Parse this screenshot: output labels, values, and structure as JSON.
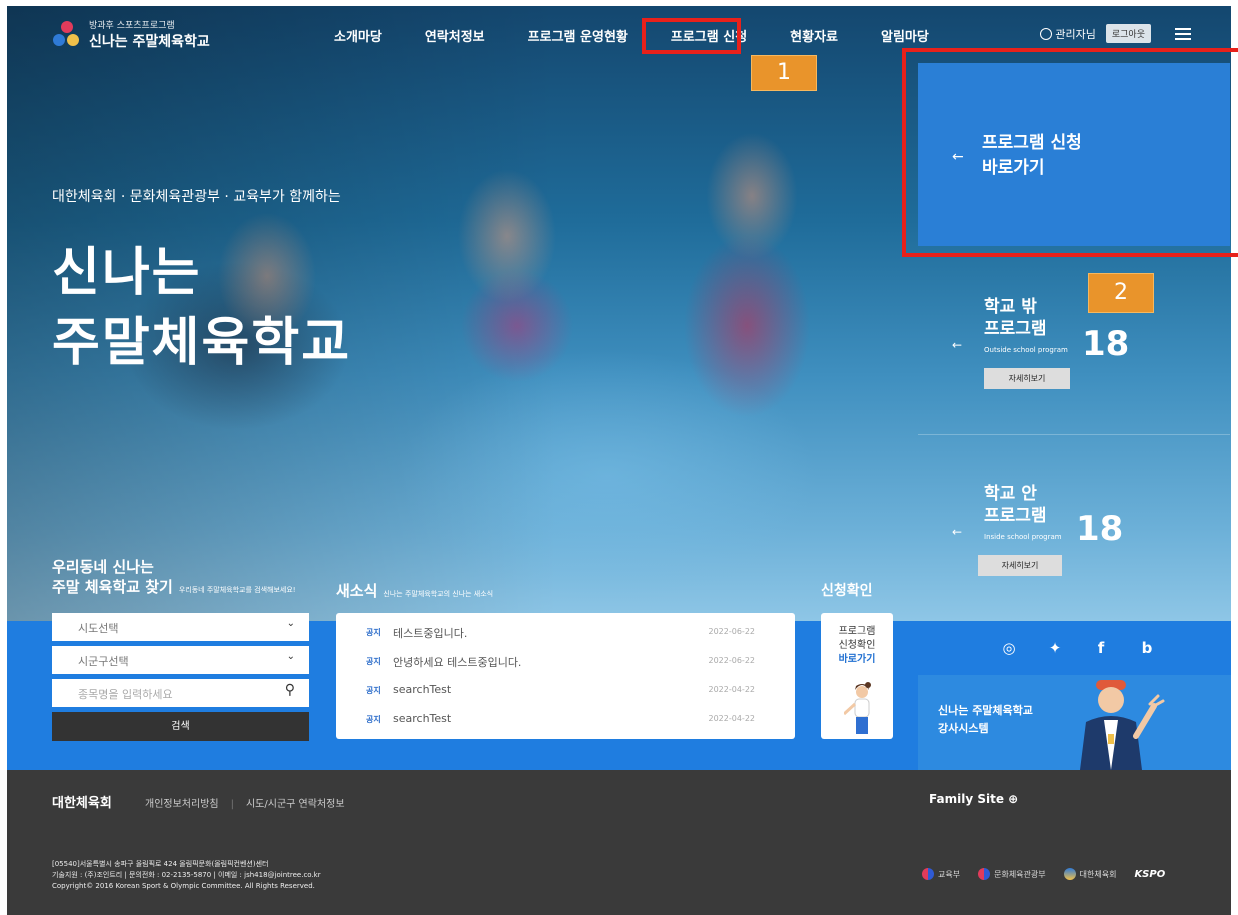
{
  "header": {
    "logo_sub": "방과후 스포츠프로그램",
    "logo_title": "신나는 주말체육학교",
    "nav": [
      "소개마당",
      "연락처정보",
      "프로그램 운영현황",
      "프로그램 신청",
      "현황자료",
      "알림마당"
    ],
    "user": "관리자님",
    "logout": "로그아웃"
  },
  "annotations": {
    "badge_1": "1",
    "badge_2": "2"
  },
  "hero": {
    "subtitle": "대한체육회 · 문화체육관광부 · 교육부가 함께하는",
    "title_line1": "신나는",
    "title_line2": "주말체육학교"
  },
  "panels": {
    "apply": {
      "line1": "프로그램 신청",
      "line2": "바로가기",
      "arrow": "←"
    },
    "outside": {
      "line1": "학교 밖",
      "line2": "프로그램",
      "en": "Outside school program",
      "count": "18",
      "more": "자세히보기"
    },
    "inside": {
      "line1": "학교 안",
      "line2": "프로그램",
      "en": "Inside school program",
      "count": "18",
      "more": "자세히보기"
    }
  },
  "search": {
    "title_line1": "우리동네 신나는",
    "title_line2": "주말 체육학교 찾기",
    "hint": "우리동네 주말체육학교를 검색해보세요!",
    "sido": "시도선택",
    "sigungu": "시군구선택",
    "keyword_placeholder": "종목명을 입력하세요",
    "button": "검색"
  },
  "news": {
    "title": "새소식",
    "hint": "신나는 주말체육학교의 신나는 새소식",
    "items": [
      {
        "tag": "공지",
        "title": "테스트중입니다.",
        "date": "2022-06-22"
      },
      {
        "tag": "공지",
        "title": "안녕하세요 테스트중입니다.",
        "date": "2022-06-22"
      },
      {
        "tag": "공지",
        "title": "searchTest",
        "date": "2022-04-22"
      },
      {
        "tag": "공지",
        "title": "searchTest",
        "date": "2022-04-22"
      }
    ]
  },
  "check": {
    "title": "신청확인",
    "line1": "프로그램",
    "line2": "신청확인",
    "go": "바로가기"
  },
  "instructor": {
    "line1": "신나는 주말체육학교",
    "line2": "강사시스템"
  },
  "footer": {
    "brand": "대한체육회",
    "links": [
      "개인정보처리방침",
      "시도/시군구 연락처정보"
    ],
    "family": "Family Site",
    "address": "[05540]서울특별시 송파구 올림픽로 424 올림픽문화(올림픽컨벤션)센터",
    "tech": "기술지원 : (주)조인트리 | 문의전화 : 02-2135-5870 | 이메일 : jsh418@jointree.co.kr",
    "copyright": "Copyright© 2016 Korean Sport & Olympic Committee. All Rights Reserved.",
    "logos": [
      "교육부",
      "문화체육관광부",
      "대한체육회",
      "KSPO"
    ]
  },
  "colors": {
    "accent": "#1f7de0",
    "highlight": "#e8211b",
    "badge": "#e9942b"
  }
}
